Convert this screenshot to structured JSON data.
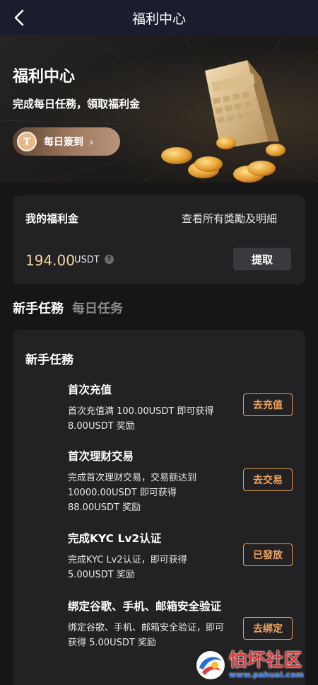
{
  "nav": {
    "title": "福利中心"
  },
  "hero": {
    "title": "福利中心",
    "subtitle": "完成每日任務，領取福利金",
    "checkin_label": "每日簽到"
  },
  "wallet": {
    "label": "我的福利金",
    "detail_link": "查看所有獎勵及明細",
    "amount": "194.00",
    "unit": "USDT",
    "withdraw_label": "提取"
  },
  "tabs": [
    {
      "label": "新手任務",
      "active": true
    },
    {
      "label": "每日任务",
      "active": false
    }
  ],
  "tasks": {
    "heading": "新手任務",
    "items": [
      {
        "title": "首次充值",
        "desc": "首次充值满 100.00USDT 即可获得 8.00USDT 奖励",
        "button": "去充值"
      },
      {
        "title": "首次理财交易",
        "desc": "完成首次理财交易，交易额达到 10000.00USDT 即可获得 88.00USDT 奖励",
        "button": "去交易"
      },
      {
        "title": "完成KYC Lv2认证",
        "desc": "完成KYC Lv2认证，即可获得 5.00USDT 奖励",
        "button": "已發放"
      },
      {
        "title": "绑定谷歌、手机、邮箱安全验证",
        "desc": "绑定谷歌、手机、邮箱安全验证，即可获得 5.00USDT 奖励",
        "button": "去绑定"
      }
    ]
  },
  "watermark": {
    "text": "怕坏社区",
    "url": "www.pahuai.com"
  },
  "colors": {
    "accent": "#f0a45b",
    "amount": "#f2d7a4",
    "background": "#161616",
    "card": "#222224"
  }
}
